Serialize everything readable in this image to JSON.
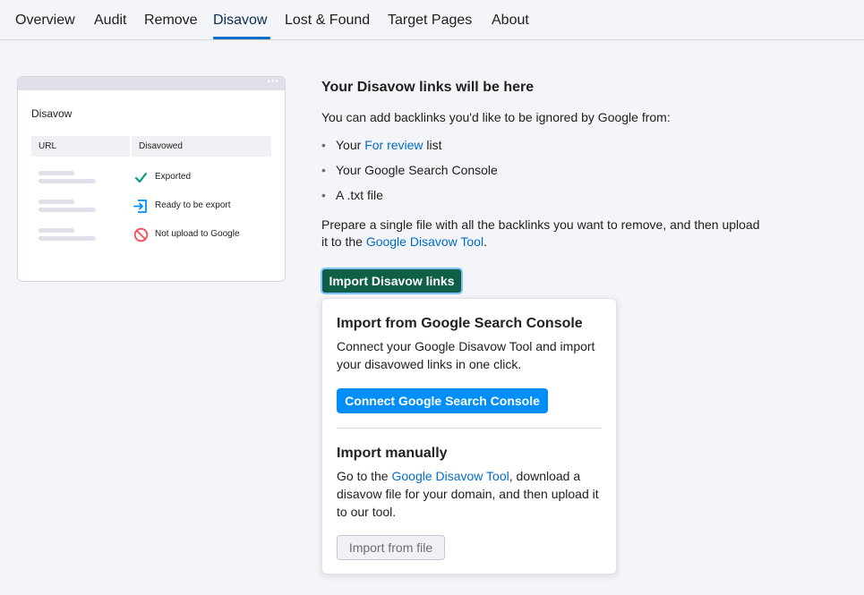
{
  "tabs": [
    {
      "label": "Overview"
    },
    {
      "label": "Audit"
    },
    {
      "label": "Remove"
    },
    {
      "label": "Disavow",
      "active": true
    },
    {
      "label": "Lost & Found"
    },
    {
      "label": "Target Pages"
    },
    {
      "label": "About"
    }
  ],
  "preview": {
    "dots": "•••",
    "title": "Disavow",
    "col_url": "URL",
    "col_disavowed": "Disavowed",
    "rows": [
      {
        "icon": "check-icon",
        "label": "Exported"
      },
      {
        "icon": "export-icon",
        "label": "Ready to be export"
      },
      {
        "icon": "forbidden-icon",
        "label": "Not upload to Google"
      }
    ]
  },
  "content": {
    "heading": "Your Disavow links will be here",
    "intro": "You can add backlinks you'd like to be ignored by Google from:",
    "bullets": {
      "b1_prefix": "Your ",
      "b1_link": "For review",
      "b1_suffix": " list",
      "b2": "Your Google Search Console",
      "b3": "A .txt file",
      "dot": "•"
    },
    "prepare_text": "Prepare a single file with all the backlinks you want to remove, and then upload it to the ",
    "prepare_link": "Google Disavow Tool",
    "prepare_end": "."
  },
  "import_button": "Import Disavow links",
  "dropdown": {
    "gsc_heading": "Import from Google Search Console",
    "gsc_text": "Connect your Google Disavow Tool and import your disavowed links in one click.",
    "gsc_button": "Connect Google Search Console",
    "manual_heading": "Import manually",
    "manual_text_1": "Go to the ",
    "manual_link": "Google Disavow Tool",
    "manual_text_2": ", download a disavow file for your domain, and then upload it to our tool.",
    "file_button": "Import from file"
  },
  "colors": {
    "accent_link": "#006dca",
    "import_button_bg": "#0f5f47",
    "connect_button_bg": "#008ff8",
    "check": "#009f81",
    "export": "#008ff8",
    "forbidden": "#ff4953"
  }
}
